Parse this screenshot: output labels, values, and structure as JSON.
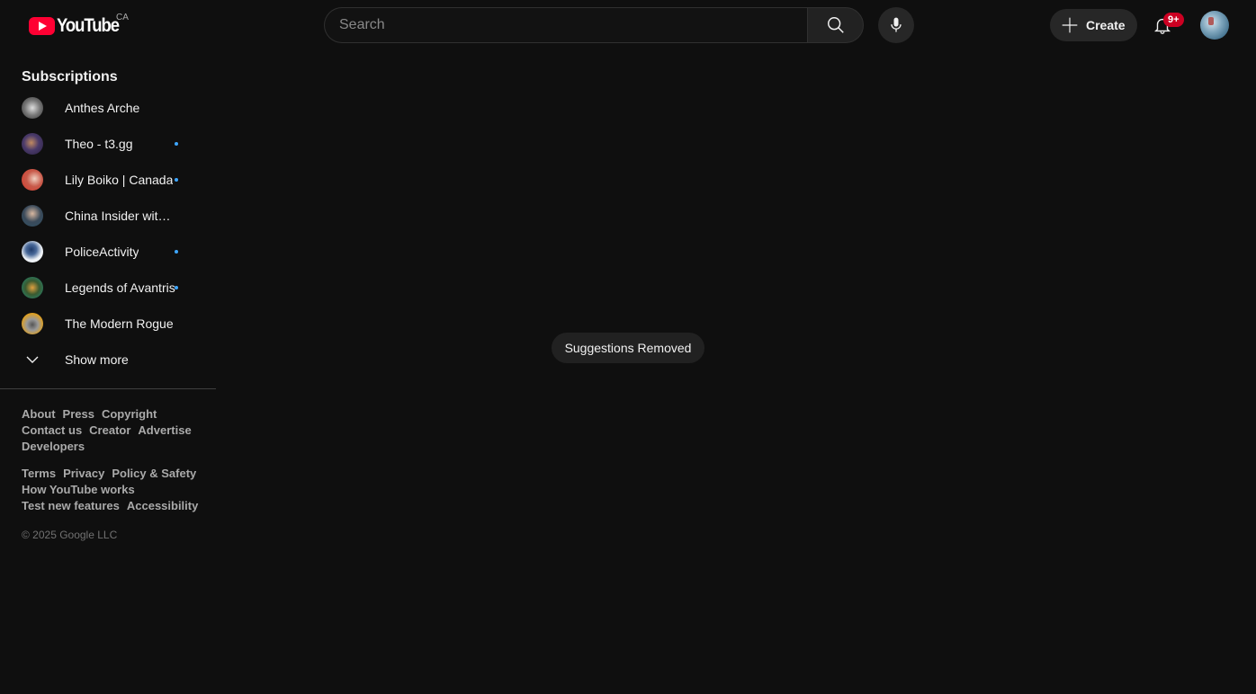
{
  "header": {
    "logo_text": "YouTube",
    "country_code": "CA",
    "search_placeholder": "Search",
    "search_value": "",
    "create_label": "Create",
    "notification_badge": "9+",
    "brand_color": "#ff0033",
    "badge_color": "#cc0022"
  },
  "sidebar": {
    "subscriptions_title": "Subscriptions",
    "subscriptions": [
      {
        "name": "Anthes Arche",
        "new_content": false,
        "avatar_color": "#8a8a8a"
      },
      {
        "name": "Theo - t3.gg",
        "new_content": true,
        "avatar_color": "#3c2f5a"
      },
      {
        "name": "Lily Boiko | Canada",
        "new_content": true,
        "avatar_color": "#d33a2c"
      },
      {
        "name": "China Insider with David Zhang",
        "new_content": false,
        "avatar_color": "#2f4f63"
      },
      {
        "name": "PoliceActivity",
        "new_content": true,
        "avatar_color": "#e8ecf2"
      },
      {
        "name": "Legends of Avantris",
        "new_content": true,
        "avatar_color": "#1f8a7a"
      },
      {
        "name": "The Modern Rogue",
        "new_content": false,
        "avatar_color": "#e0a020"
      }
    ],
    "show_more_label": "Show more",
    "new_content_dot_color": "#3ea6ff"
  },
  "footer": {
    "group1": [
      [
        "About",
        "Press",
        "Copyright"
      ],
      [
        "Contact us",
        "Creator",
        "Advertise"
      ],
      [
        "Developers"
      ]
    ],
    "group2": [
      [
        "Terms",
        "Privacy",
        "Policy & Safety"
      ],
      [
        "How YouTube works"
      ],
      [
        "Test new features",
        "Accessibility"
      ]
    ],
    "copyright": "© 2025 Google LLC"
  },
  "toast": {
    "message": "Suggestions Removed"
  }
}
